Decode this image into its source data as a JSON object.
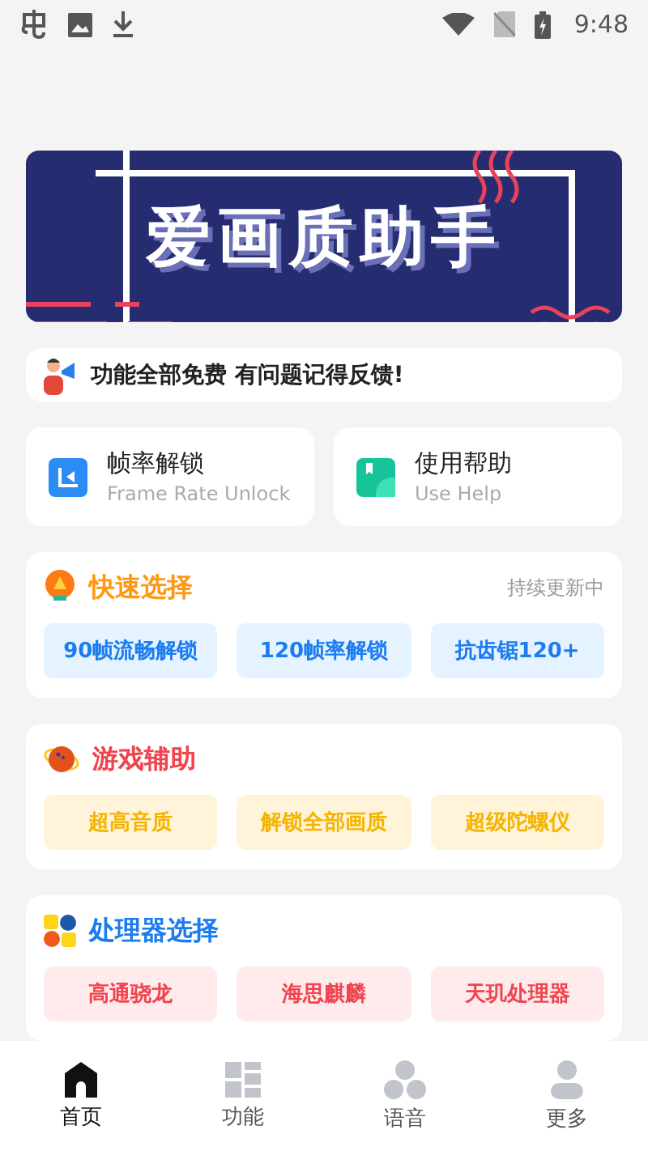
{
  "status_bar": {
    "time": "9:48"
  },
  "banner": {
    "title": "爱画质助手"
  },
  "notice": {
    "text": "功能全部免费 有问题记得反馈!"
  },
  "shortcuts": [
    {
      "kind": "frame",
      "title": "帧率解锁",
      "subtitle": "Frame Rate Unlock"
    },
    {
      "kind": "help",
      "title": "使用帮助",
      "subtitle": "Use Help"
    }
  ],
  "sections": [
    {
      "kind": "quick",
      "title": "快速选择",
      "note": "持续更新中",
      "options": [
        "90帧流畅解锁",
        "120帧率解锁",
        "抗齿锯120+"
      ]
    },
    {
      "kind": "game",
      "title": "游戏辅助",
      "options": [
        "超高音质",
        "解锁全部画质",
        "超级陀螺仪"
      ]
    },
    {
      "kind": "cpu",
      "title": "处理器选择",
      "options": [
        "高通骁龙",
        "海思麒麟",
        "天玑处理器"
      ]
    }
  ],
  "nav": [
    {
      "kind": "home",
      "label": "首页",
      "selected": true
    },
    {
      "kind": "features",
      "label": "功能",
      "selected": false
    },
    {
      "kind": "voice",
      "label": "语音",
      "selected": false
    },
    {
      "kind": "more",
      "label": "更多",
      "selected": false
    }
  ]
}
